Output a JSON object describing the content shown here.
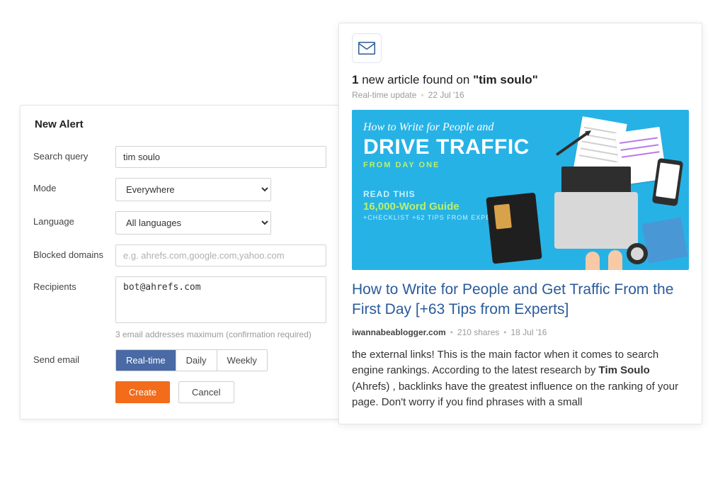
{
  "alert": {
    "title": "New Alert",
    "search_query_label": "Search query",
    "search_query_value": "tim soulo",
    "mode_label": "Mode",
    "mode_value": "Everywhere",
    "language_label": "Language",
    "language_value": "All languages",
    "blocked_label": "Blocked domains",
    "blocked_placeholder": "e.g. ahrefs.com,google.com,yahoo.com",
    "recipients_label": "Recipients",
    "recipients_value": "bot@ahrefs.com",
    "recipients_hint": "3 email addresses maximum (confirmation required)",
    "send_label": "Send email",
    "freq": {
      "realtime": "Real-time",
      "daily": "Daily",
      "weekly": "Weekly"
    },
    "create": "Create",
    "cancel": "Cancel"
  },
  "mail": {
    "count": "1",
    "found_mid": " new article found on ",
    "found_q_open": "\"",
    "found_q_term": "tim soulo",
    "found_q_close": "\"",
    "update_kind": "Real-time update",
    "update_date": "22 Jul '16",
    "img": {
      "line1": "How to Write for People and",
      "line2": "DRIVE TRAFFIC",
      "line3": "FROM DAY ONE",
      "line4": "READ THIS",
      "line5": "16,000-Word Guide",
      "line6": "+CHECKLIST +62 TIPS FROM EXPERTS"
    },
    "article_title": "How to Write for People and Get Traffic From the First Day [+63 Tips from Experts]",
    "site": "iwannabeablogger.com",
    "shares": "210 shares",
    "pub_date": "18 Jul '16",
    "excerpt_pre": "the external links! This is the main factor when it comes to search engine rankings. According to the latest research by ",
    "excerpt_bold": "Tim Soulo",
    "excerpt_post": " (Ahrefs) , backlinks have the greatest influence on the ranking of your page. Don't worry if you find phrases with a small"
  }
}
